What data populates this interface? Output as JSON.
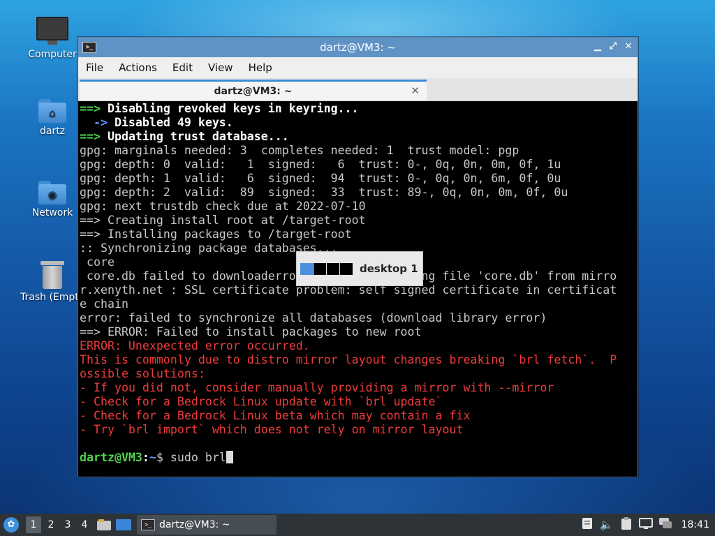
{
  "desktop": {
    "icons": [
      {
        "label": "Computer",
        "icon": "computer-icon"
      },
      {
        "label": "dartz",
        "icon": "home-folder-icon"
      },
      {
        "label": "Network",
        "icon": "network-folder-icon"
      },
      {
        "label": "Trash (Empty)",
        "icon": "trash-icon"
      }
    ]
  },
  "window": {
    "title": "dartz@VM3: ~",
    "app_icon_glyph": ">_",
    "controls": [
      "minimize",
      "maximize",
      "close"
    ],
    "menu": [
      "File",
      "Actions",
      "Edit",
      "View",
      "Help"
    ],
    "tab_label": "dartz@VM3: ~",
    "tab_close": "✕"
  },
  "terminal": {
    "lines": [
      {
        "arrow": "==> ",
        "text": "Disabling revoked keys in keyring...",
        "style": "header"
      },
      {
        "arrow": "  -> ",
        "text": "Disabled 49 keys.",
        "style": "sub"
      },
      {
        "arrow": "==> ",
        "text": "Updating trust database...",
        "style": "header"
      },
      {
        "text": "gpg: marginals needed: 3  completes needed: 1  trust model: pgp"
      },
      {
        "text": "gpg: depth: 0  valid:   1  signed:   6  trust: 0-, 0q, 0n, 0m, 0f, 1u"
      },
      {
        "text": "gpg: depth: 1  valid:   6  signed:  94  trust: 0-, 0q, 0n, 6m, 0f, 0u"
      },
      {
        "text": "gpg: depth: 2  valid:  89  signed:  33  trust: 89-, 0q, 0n, 0m, 0f, 0u"
      },
      {
        "text": "gpg: next trustdb check due at 2022-07-10"
      },
      {
        "text": "==> Creating install root at /target-root"
      },
      {
        "text": "==> Installing packages to /target-root"
      },
      {
        "text": ":: Synchronizing package databases..."
      },
      {
        "text": " core"
      },
      {
        "text": " core.db failed to downloaderror: failed retrieving file 'core.db' from mirro"
      },
      {
        "text": "r.xenyth.net : SSL certificate problem: self signed certificate in certificat"
      },
      {
        "text": "e chain"
      },
      {
        "text": "error: failed to synchronize all databases (download library error)"
      },
      {
        "text": "==> ERROR: Failed to install packages to new root"
      },
      {
        "text": "ERROR: Unexpected error occurred.",
        "style": "error"
      },
      {
        "text": "This is commonly due to distro mirror layout changes breaking `brl fetch`.  P",
        "style": "error"
      },
      {
        "text": "ossible solutions:",
        "style": "error"
      },
      {
        "text": "- If you did not, consider manually providing a mirror with --mirror",
        "style": "error"
      },
      {
        "text": "- Check for a Bedrock Linux update with `brl update`",
        "style": "error"
      },
      {
        "text": "- Check for a Bedrock Linux beta which may contain a fix",
        "style": "error"
      },
      {
        "text": "- Try `brl import` which does not rely on mirror layout",
        "style": "error"
      },
      {
        "text": ""
      }
    ],
    "prompt": {
      "user_host": "dartz@VM3",
      "sep": ":",
      "path": "~",
      "symbol": "$ ",
      "input": "sudo brl"
    }
  },
  "desktop_switcher": {
    "label": "desktop 1",
    "count": 4,
    "active_index": 0
  },
  "taskbar": {
    "start_icon": "start-menu-icon",
    "workspaces": [
      "1",
      "2",
      "3",
      "4"
    ],
    "active_workspace": "1",
    "launchers": [
      "file-manager-icon",
      "show-desktop-icon"
    ],
    "task_label": "dartz@VM3: ~",
    "tray_icons": [
      "notes-icon",
      "volume-icon",
      "clipboard-icon",
      "network-icon",
      "chat-icon"
    ],
    "clock": "18:41"
  },
  "colors": {
    "accent": "#5f93c6",
    "prompt_green": "#4fd24f",
    "prompt_blue": "#5b9cff",
    "error_red": "#ee3b3b"
  }
}
